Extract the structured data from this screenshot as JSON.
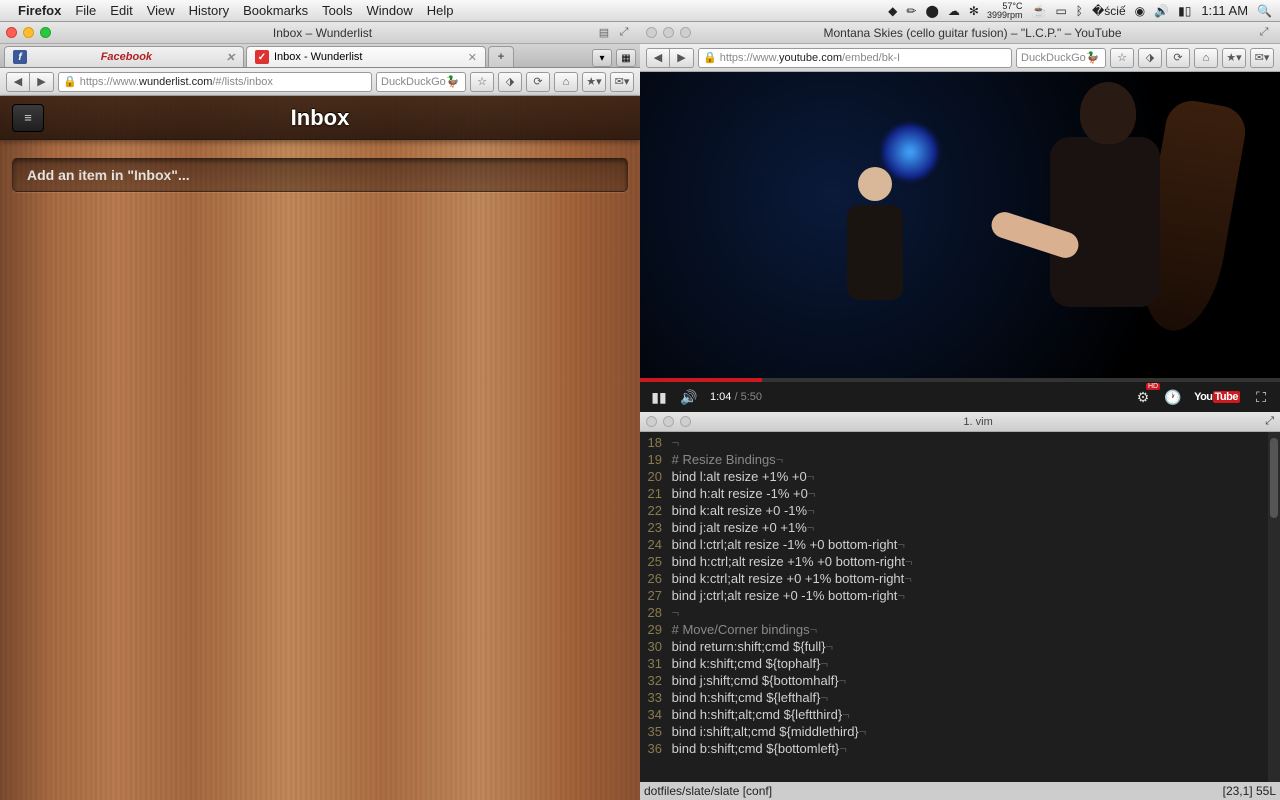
{
  "menubar": {
    "app": "Firefox",
    "items": [
      "File",
      "Edit",
      "View",
      "History",
      "Bookmarks",
      "Tools",
      "Window",
      "Help"
    ],
    "temp": "57°C",
    "rpm": "3999rpm",
    "clock": "1:11 AM"
  },
  "left_window": {
    "title": "Inbox – Wunderlist",
    "tabs": {
      "fb": "Facebook",
      "wl": "Inbox - Wunderlist"
    },
    "url_prefix": "https://www.",
    "url_host": "wunderlist.com",
    "url_path": "/#/lists/inbox",
    "search": "DuckDuckGo"
  },
  "wunderlist": {
    "title": "Inbox",
    "placeholder": "Add an item in \"Inbox\"..."
  },
  "right_window": {
    "title": "Montana Skies (cello guitar fusion) – \"L.C.P.\" – YouTube",
    "url_prefix": "https://www.",
    "url_host": "youtube.com",
    "url_path": "/embed/bk-I",
    "search": "DuckDuckGo"
  },
  "youtube": {
    "time": "1:04",
    "duration": "5:50"
  },
  "terminal": {
    "title": "1. vim",
    "status_left": "dotfiles/slate/slate [conf]",
    "status_right": "[23,1]  55L",
    "lines": [
      {
        "n": 18,
        "t": "",
        "c": ""
      },
      {
        "n": 19,
        "t": "# Resize Bindings",
        "c": "cm"
      },
      {
        "n": 20,
        "t": "bind l:alt resize +1% +0",
        "c": ""
      },
      {
        "n": 21,
        "t": "bind h:alt resize -1% +0",
        "c": ""
      },
      {
        "n": 22,
        "t": "bind k:alt resize +0 -1%",
        "c": ""
      },
      {
        "n": 23,
        "t": "bind j:alt resize +0 +1%",
        "c": ""
      },
      {
        "n": 24,
        "t": "bind l:ctrl;alt resize -1% +0 bottom-right",
        "c": ""
      },
      {
        "n": 25,
        "t": "bind h:ctrl;alt resize +1% +0 bottom-right",
        "c": ""
      },
      {
        "n": 26,
        "t": "bind k:ctrl;alt resize +0 +1% bottom-right",
        "c": ""
      },
      {
        "n": 27,
        "t": "bind j:ctrl;alt resize +0 -1% bottom-right",
        "c": ""
      },
      {
        "n": 28,
        "t": "",
        "c": ""
      },
      {
        "n": 29,
        "t": "# Move/Corner bindings",
        "c": "cm"
      },
      {
        "n": 30,
        "t": "bind return:shift;cmd ${full}",
        "c": ""
      },
      {
        "n": 31,
        "t": "bind k:shift;cmd ${tophalf}",
        "c": ""
      },
      {
        "n": 32,
        "t": "bind j:shift;cmd ${bottomhalf}",
        "c": ""
      },
      {
        "n": 33,
        "t": "bind h:shift;cmd ${lefthalf}",
        "c": ""
      },
      {
        "n": 34,
        "t": "bind h:shift;alt;cmd ${leftthird}",
        "c": ""
      },
      {
        "n": 35,
        "t": "bind i:shift;alt;cmd ${middlethird}",
        "c": ""
      },
      {
        "n": 36,
        "t": "bind b:shift;cmd ${bottomleft}",
        "c": ""
      }
    ]
  }
}
